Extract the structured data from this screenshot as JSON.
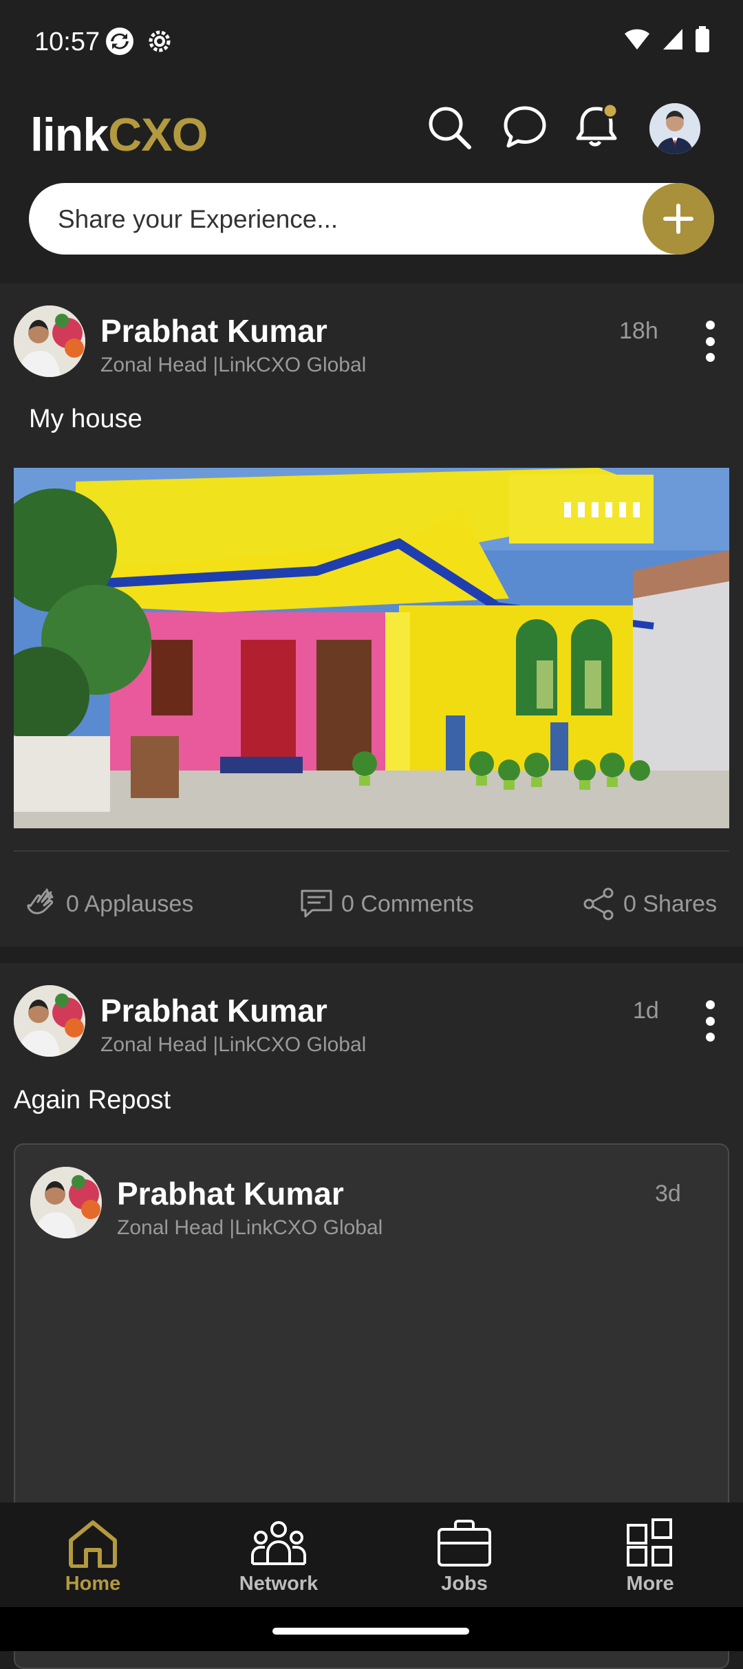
{
  "status_bar": {
    "time": "10:57"
  },
  "header": {
    "logo_left": "link",
    "logo_right": "CXO",
    "share_placeholder": "Share your Experience...",
    "icons": [
      "search-icon",
      "chat-icon",
      "notification-bell-icon",
      "profile-avatar"
    ]
  },
  "posts": [
    {
      "author": "Prabhat Kumar",
      "role": "Zonal Head |LinkCXO Global",
      "time": "18h",
      "text": "My house",
      "applauses": "0 Applauses",
      "comments": "0 Comments",
      "shares": "0 Shares"
    },
    {
      "author": "Prabhat Kumar",
      "role": "Zonal Head |LinkCXO Global",
      "time": "1d",
      "text": "Again Repost",
      "repost": {
        "author": "Prabhat Kumar",
        "role": "Zonal Head |LinkCXO Global",
        "time": "3d"
      }
    }
  ],
  "bottom_nav": {
    "items": [
      {
        "label": "Home",
        "icon": "home-icon",
        "active": true
      },
      {
        "label": "Network",
        "icon": "network-icon",
        "active": false
      },
      {
        "label": "Jobs",
        "icon": "briefcase-icon",
        "active": false
      },
      {
        "label": "More",
        "icon": "grid-icon",
        "active": false
      }
    ]
  },
  "colors": {
    "accent": "#a8913a",
    "background": "#1f1f1f",
    "card": "#272727",
    "muted_text": "#9a9a9a"
  }
}
